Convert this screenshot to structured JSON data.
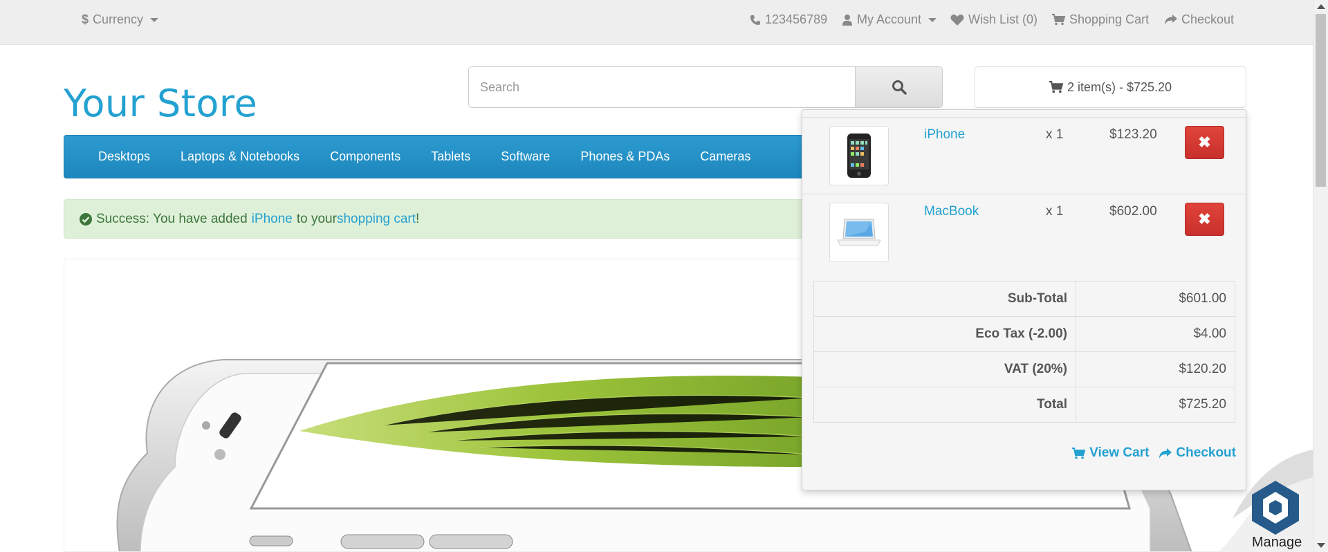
{
  "topbar": {
    "currency_label": "Currency",
    "phone": "123456789",
    "account": "My Account",
    "wishlist": "Wish List (0)",
    "shopping_cart": "Shopping Cart",
    "checkout": "Checkout"
  },
  "header": {
    "logo": "Your Store",
    "search_placeholder": "Search",
    "cart_summary": "2 item(s) - $725.20"
  },
  "nav": {
    "items": [
      "Desktops",
      "Laptops & Notebooks",
      "Components",
      "Tablets",
      "Software",
      "Phones & PDAs",
      "Cameras"
    ]
  },
  "alert": {
    "prefix": "Success: You have added",
    "product": "iPhone",
    "middle": "to your",
    "link": "shopping cart",
    "suffix": "!"
  },
  "cart": {
    "items": [
      {
        "name": "iPhone",
        "qty": "x 1",
        "price": "$123.20",
        "remove": "✖"
      },
      {
        "name": "MacBook",
        "qty": "x 1",
        "price": "$602.00",
        "remove": "✖"
      }
    ],
    "totals": [
      {
        "label": "Sub-Total",
        "value": "$601.00"
      },
      {
        "label": "Eco Tax (-2.00)",
        "value": "$4.00"
      },
      {
        "label": "VAT (20%)",
        "value": "$120.20"
      },
      {
        "label": "Total",
        "value": "$725.20"
      }
    ],
    "view_cart": "View Cart",
    "checkout": "Checkout"
  },
  "widget": {
    "manage_label": "Manage"
  }
}
